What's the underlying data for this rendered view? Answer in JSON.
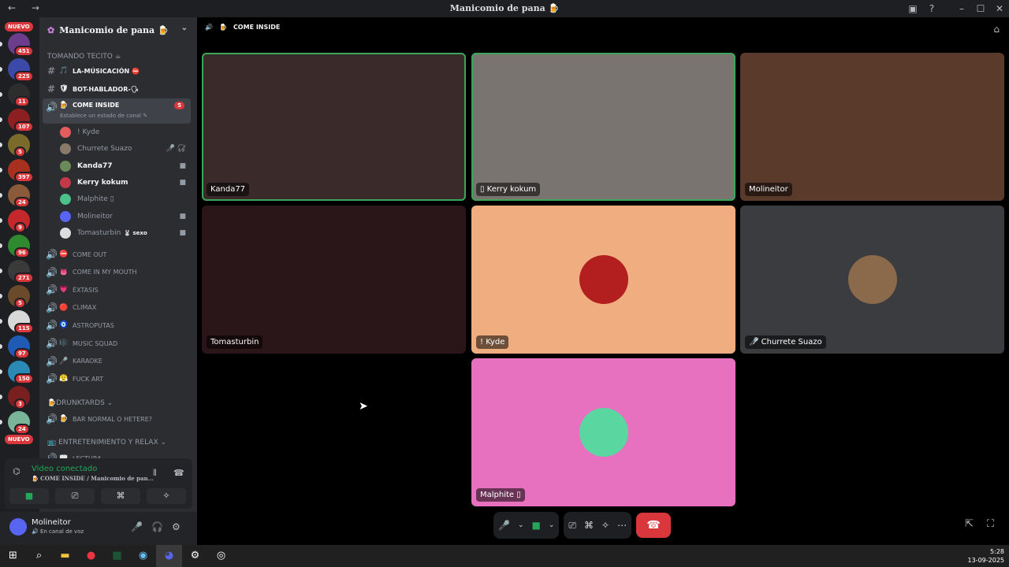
{
  "titlebar": {
    "title": "Manicomio de pana",
    "title_emoji": "🍺"
  },
  "guilds": {
    "nuevo_label": "NUEVO",
    "items": [
      {
        "badge": "451",
        "color": "#6b3d8c"
      },
      {
        "badge": "225",
        "color": "#3b4aa8"
      },
      {
        "badge": "11",
        "color": "#2d2d2d"
      },
      {
        "badge": "107",
        "color": "#8c1f1f"
      },
      {
        "badge": "5",
        "color": "#7a6b2a"
      },
      {
        "badge": "397",
        "color": "#a8301f"
      },
      {
        "badge": "24",
        "color": "#8a5a3a"
      },
      {
        "badge": "9",
        "color": "#c4282a"
      },
      {
        "badge": "96",
        "color": "#2f8a2f"
      },
      {
        "badge": "271",
        "color": "#3a3a3a"
      },
      {
        "badge": "5",
        "color": "#6a4a2a"
      },
      {
        "badge": "115",
        "color": "#d8d8d8"
      },
      {
        "badge": "97",
        "color": "#1f5ab5"
      },
      {
        "badge": "150",
        "color": "#2a8ab5"
      },
      {
        "badge": "3",
        "color": "#7a1f1f"
      },
      {
        "badge": "24",
        "color": "#7ab59a"
      }
    ]
  },
  "server": {
    "name": "Manicomio de pana",
    "emoji": "🍺"
  },
  "categories": {
    "tomando": "TOMANDO TECITO ☕",
    "drunk": "DRUNKTARDS",
    "entre": "ENTRETENIMIENTO Y RELAX"
  },
  "channels": [
    {
      "name": "LA-MÚSICACIÓN ⛔",
      "emoji": "🎵",
      "type": "text"
    },
    {
      "name": "BOT-HABLADOR-🗣",
      "emoji": "🛡",
      "type": "text"
    },
    {
      "name": "COME INSIDE",
      "emoji": "🍺",
      "type": "voice",
      "badge": "5"
    }
  ],
  "channel_status": "Establece un estado de canal",
  "voice_users": [
    {
      "name": "! Kyde",
      "color": "#e35d5d"
    },
    {
      "name": "Churrete Suazo",
      "color": "#8a7a6a",
      "icon": "🎤̸ 🎧̸"
    },
    {
      "name": "Kanda77",
      "color": "#6a8a5a",
      "icon": "■",
      "bold": true
    },
    {
      "name": "Kerry kokum",
      "color": "#c23a4a",
      "icon": "■",
      "bold": true
    },
    {
      "name": "Malphite ▯",
      "color": "#4ac28a"
    },
    {
      "name": "Molineitor",
      "color": "#5865f2",
      "icon": "■"
    },
    {
      "name": "Tomasturbin",
      "tag": "🐰 sexo",
      "color": "#ddd",
      "icon": "■"
    }
  ],
  "voice_channels": [
    {
      "name": "COME OUT",
      "emoji": "⛔"
    },
    {
      "name": "COME IN MY MOUTH",
      "emoji": "👅"
    },
    {
      "name": "ÉXTASIS",
      "emoji": "💗"
    },
    {
      "name": "CLIMAX",
      "emoji": "🔴"
    },
    {
      "name": "ASTROPUTAS",
      "emoji": "🧿"
    },
    {
      "name": "MUSIC SQUAD",
      "emoji": "🎼"
    },
    {
      "name": "KARAOKE",
      "emoji": "🎤"
    },
    {
      "name": "FUCK ART",
      "emoji": "😤"
    }
  ],
  "drunk_channels": [
    {
      "name": "BAR NORMAL O HETERE?",
      "emoji": "🍺"
    }
  ],
  "entre_channels": [
    {
      "name": "LECTURA",
      "emoji": "📖"
    }
  ],
  "voice_panel": {
    "status": "Video conectado",
    "sub": "COME INSIDE / Manicomio de pan..."
  },
  "userbar": {
    "name": "Molineitor",
    "status": "En canal de voz"
  },
  "main_header": {
    "channel": "COME INSIDE"
  },
  "tiles": [
    {
      "name": "Kanda77",
      "bg": "#3a2a2a"
    },
    {
      "name": "Kerry kokum",
      "bg": "#7a7470",
      "prefix": "▯ "
    },
    {
      "name": "Molineitor",
      "bg": "#5a3a2a"
    },
    {
      "name": "Tomasturbin",
      "bg": "#2a1518"
    },
    {
      "name": "! Kyde",
      "bg": "#f0ad7f"
    },
    {
      "name": "Churrete Suazo",
      "bg": "#3b3c40",
      "prefix": "🎤̸ "
    },
    {
      "name": "Malphite ▯",
      "bg": "#e871bf"
    }
  ],
  "clock": {
    "time": "5:28",
    "date": "13-09-2025"
  }
}
